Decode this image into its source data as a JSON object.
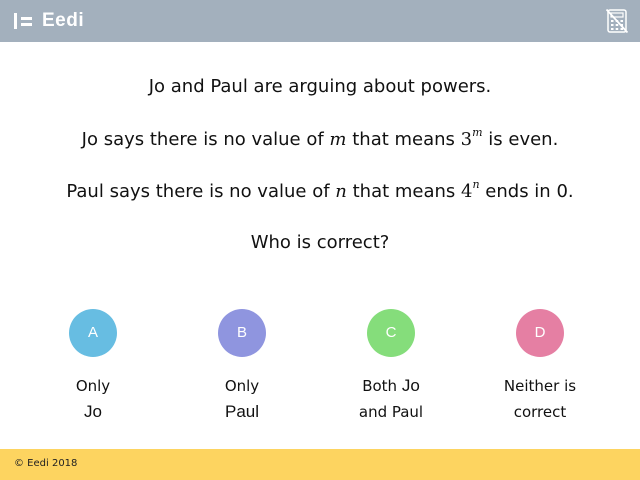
{
  "header": {
    "brand": "Eedi",
    "background": "#a3b0bd",
    "right_icon": "calculator-not-allowed-icon"
  },
  "question": {
    "line1": "Jo and Paul are arguing about powers.",
    "line2": {
      "pre": "Jo says there is no value of ",
      "var": "m",
      "mid": " that means ",
      "base": "3",
      "exp": "m",
      "post": " is even."
    },
    "line3": {
      "pre": "Paul says there is no value of ",
      "var": "n",
      "mid": " that means ",
      "base": "4",
      "exp": "n",
      "post": " ends in 0."
    },
    "line4": "Who is correct?"
  },
  "answers": [
    {
      "letter": "A",
      "color": "#67bde2",
      "line1": "Only",
      "line2": "Jo"
    },
    {
      "letter": "B",
      "color": "#8f95df",
      "line1": "Only",
      "line2": "Paul"
    },
    {
      "letter": "C",
      "color": "#85dd7b",
      "line1": "Both ",
      "line1b": "Jo",
      "line2": "and Paul"
    },
    {
      "letter": "D",
      "color": "#e57fa3",
      "line1": "Neither is",
      "line2": "correct"
    }
  ],
  "footer": {
    "copyright": "© Eedi 2018",
    "background": "#fdd460"
  }
}
